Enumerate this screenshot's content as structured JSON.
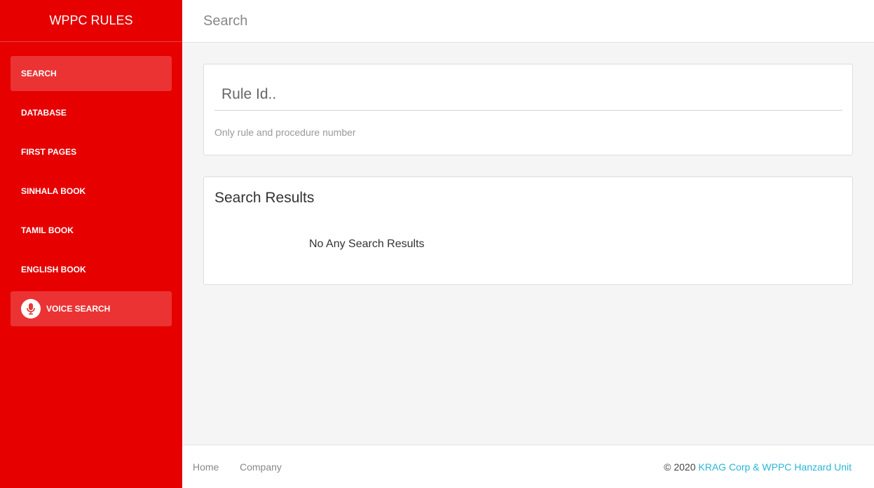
{
  "sidebar": {
    "title": "WPPC RULES",
    "items": [
      {
        "label": "SEARCH"
      },
      {
        "label": "DATABASE"
      },
      {
        "label": "FIRST PAGES"
      },
      {
        "label": "SINHALA BOOK"
      },
      {
        "label": "TAMIL BOOK"
      },
      {
        "label": "ENGLISH BOOK"
      },
      {
        "label": "VOICE SEARCH",
        "icon": "microphone-icon"
      }
    ]
  },
  "topbar": {
    "title": "Search"
  },
  "search_card": {
    "placeholder": "Rule Id..",
    "value": "",
    "hint": "Only rule and procedure number"
  },
  "results_card": {
    "title": "Search Results",
    "empty_text": "No Any Search Results"
  },
  "footer": {
    "links": [
      {
        "label": "Home"
      },
      {
        "label": "Company"
      }
    ],
    "copyright_prefix": "© 2020 ",
    "copyright_brand": "KRAG Corp & WPPC Hanzard Unit"
  },
  "colors": {
    "sidebar": "#e60000",
    "accent_link": "#29b6d8",
    "mic_icon": "#e53935"
  }
}
